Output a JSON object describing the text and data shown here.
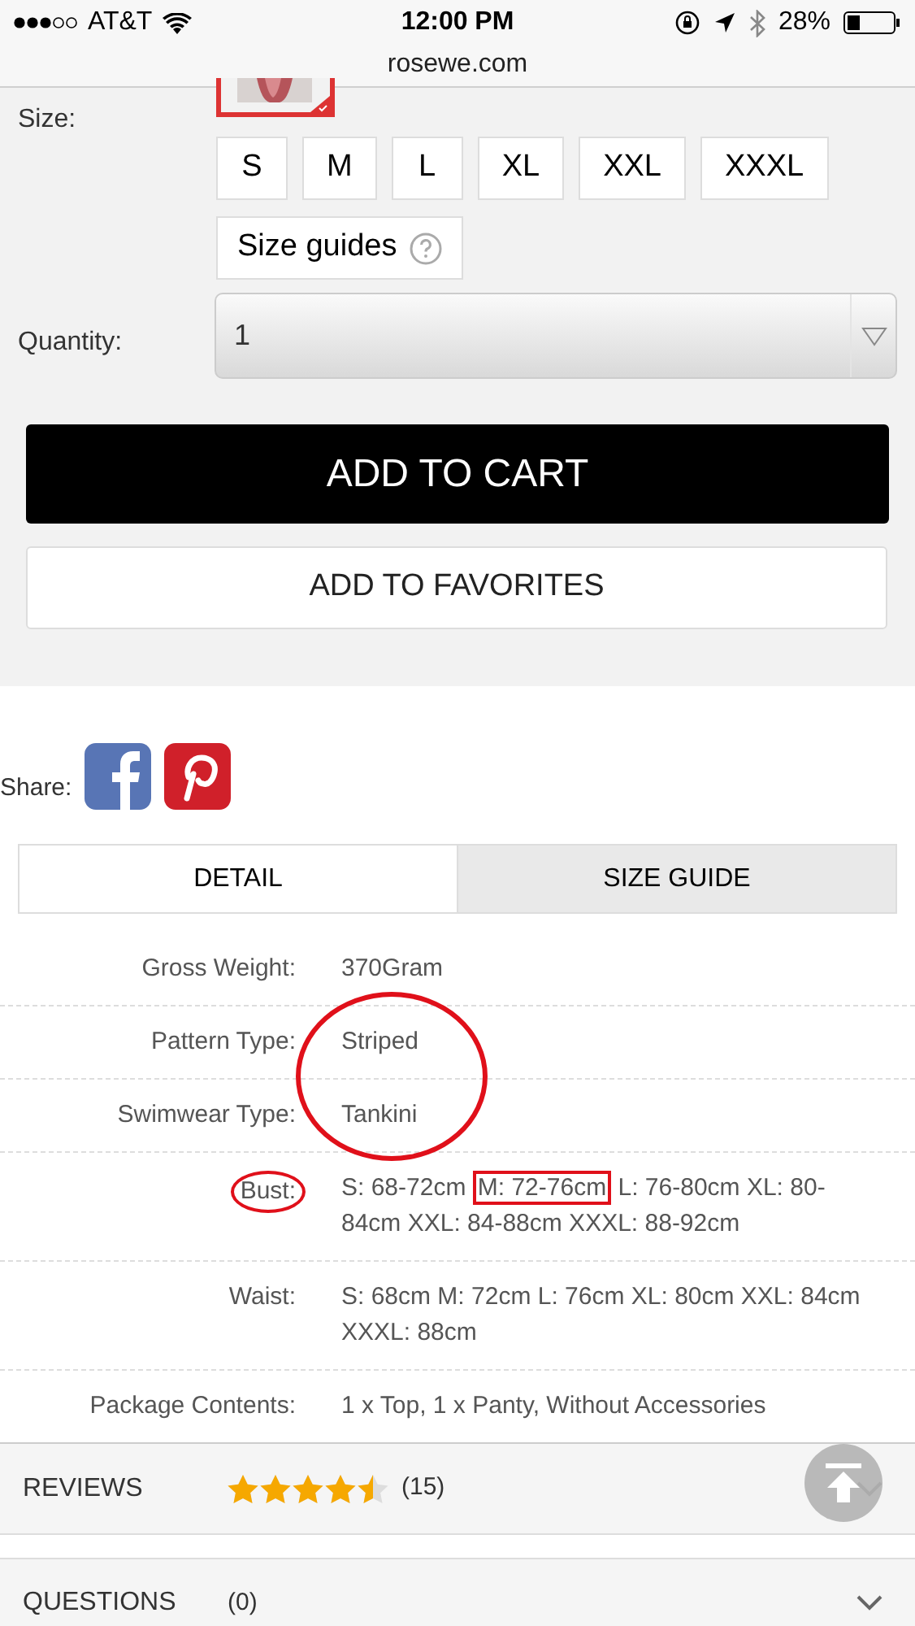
{
  "status_bar": {
    "carrier": "AT&T",
    "time": "12:00 PM",
    "battery": "28%",
    "url": "rosewe.com"
  },
  "color_swatch": {
    "selected": true
  },
  "size": {
    "label": "Size:",
    "options": [
      {
        "label": "S",
        "selected": false
      },
      {
        "label": "M",
        "selected": false
      },
      {
        "label": "L",
        "selected": false
      },
      {
        "label": "XL",
        "selected": false
      },
      {
        "label": "XXL",
        "selected": false
      },
      {
        "label": "XXXL",
        "selected": false
      }
    ],
    "guide_button": "Size guides"
  },
  "quantity": {
    "label": "Quantity:",
    "value": "1"
  },
  "add_to_cart": "ADD TO CART",
  "add_to_favorites": "ADD TO FAVORITES",
  "share": {
    "label": "Share:"
  },
  "tabs": [
    {
      "label": "DETAIL",
      "selected": true
    },
    {
      "label": "SIZE GUIDE",
      "selected": false
    }
  ],
  "specs": [
    {
      "label": "Gross Weight:",
      "value": [
        {
          "text": "370Gram"
        }
      ]
    },
    {
      "label": "Pattern Type:",
      "value": [
        {
          "text": "Striped"
        }
      ],
      "value_circled": true
    },
    {
      "label": "Swimwear Type:",
      "value": [
        {
          "text": "Tankini"
        }
      ],
      "value_circled": true
    },
    {
      "label": "Bust:",
      "label_circled": true,
      "value": [
        {
          "text": "S: 68-72cm "
        },
        {
          "text": "M: 72-76cm",
          "boxed": true
        },
        {
          "text": " L: 76-80cm XL: 80-84cm XXL: 84-88cm XXXL: 88-92cm"
        }
      ]
    },
    {
      "label": "Waist:",
      "value": [
        {
          "text": "S: 68cm M: 72cm L: 76cm XL: 80cm XXL: 84cm XXXL: 88cm"
        }
      ]
    },
    {
      "label": "Package Contents:",
      "value": [
        {
          "text": "1 x Top, 1 x Panty, Without Accessories"
        }
      ]
    }
  ],
  "sections": [
    {
      "title": "REVIEWS",
      "stars": 4.5,
      "count": "(15)",
      "expanded": false
    },
    {
      "title": "QUESTIONS",
      "count": "(0)",
      "expanded": false
    }
  ]
}
